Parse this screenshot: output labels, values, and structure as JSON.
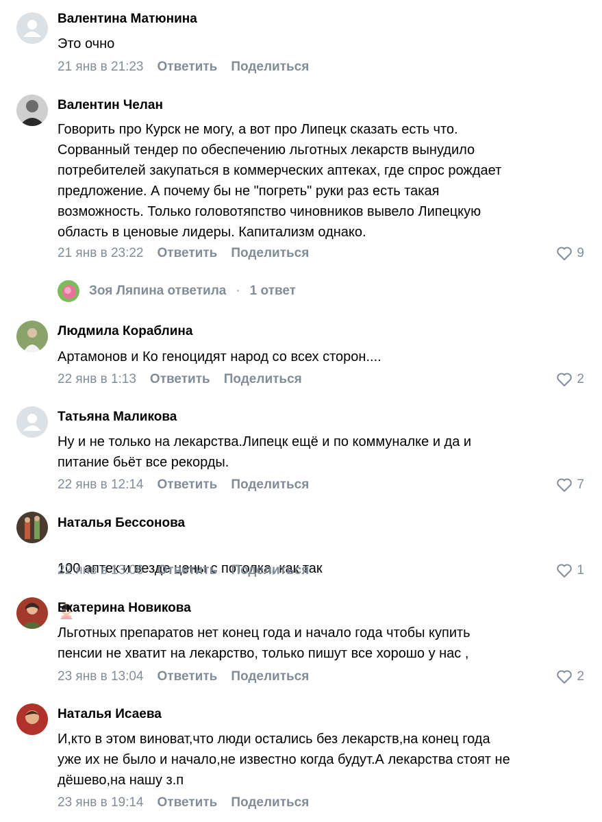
{
  "comments": [
    {
      "author": "Валентина Матюнина",
      "text": "Это очно",
      "date": "21 янв в 21:23",
      "reply_label": "Ответить",
      "share_label": "Поделиться",
      "likes": "",
      "avatar": "default-avatar-icon"
    },
    {
      "author": "Валентин Челан",
      "text": "Говорить про Курск не могу, а вот про Липецк сказать есть что.\nСорванный тендер по обеспечению льготных лекарств вынудило\nпотребителей закупаться в коммерческих аптеках, где спрос рождает\nпредложение. А почему бы не \"погреть\" руки раз есть такая\nвозможность. Только головотяпство чиновников вывело Липецкую\nобласть в ценовые лидеры. Капитализм однако.",
      "date": "21 янв в 23:22",
      "reply_label": "Ответить",
      "share_label": "Поделиться",
      "likes": "9",
      "avatar": "photo-avatar"
    },
    {
      "author": "Людмила Кораблина",
      "text": "Артамонов и Ко геноцидят народ со всех сторон....",
      "date": "22 янв в 1:13",
      "reply_label": "Ответить",
      "share_label": "Поделиться",
      "likes": "2",
      "avatar": "photo-avatar"
    },
    {
      "author": "Татьяна Маликова",
      "text": "Ну и не только на лекарства.Липецк ещё и по коммуналке и да и\nпитание бьёт все рекорды.",
      "date": "22 янв в 12:14",
      "reply_label": "Ответить",
      "share_label": "Поделиться",
      "likes": "7",
      "avatar": "default-avatar-icon"
    },
    {
      "author": "Наталья Бессонова",
      "text": "100 аптек и везде цены с потолка, как так",
      "date": "22 янв в 13:06",
      "reply_label": "Ответить",
      "share_label": "Поделиться",
      "likes": "1",
      "avatar": "photo-avatar",
      "emoji": "person-gesturing-no-emoji"
    },
    {
      "author": "Екатерина Новикова",
      "text": "Льготных препаратов нет конец года и начало года чтобы купить\nпенсии не хватит на лекарство, только пишут все хорошо у нас ,",
      "date": "23 янв в 13:04",
      "reply_label": "Ответить",
      "share_label": "Поделиться",
      "likes": "2",
      "avatar": "photo-avatar"
    },
    {
      "author": "Наталья Исаева",
      "text": "И,кто в этом виноват,что люди остались без лекарств,на конец года\nуже их не было и начало,не известно когда будут.А лекарства стоят не\nдёшево,на нашу з.п",
      "date": "23 янв в 19:14",
      "reply_label": "Ответить",
      "share_label": "Поделиться",
      "likes": "",
      "avatar": "photo-avatar"
    }
  ],
  "thread": {
    "replier": "Зоя Ляпина ответила",
    "separator": "·",
    "count": "1 ответ"
  },
  "colors": {
    "meta": "#818c99",
    "text": "#000000",
    "default_avatar_bg": "#dce1e6"
  }
}
